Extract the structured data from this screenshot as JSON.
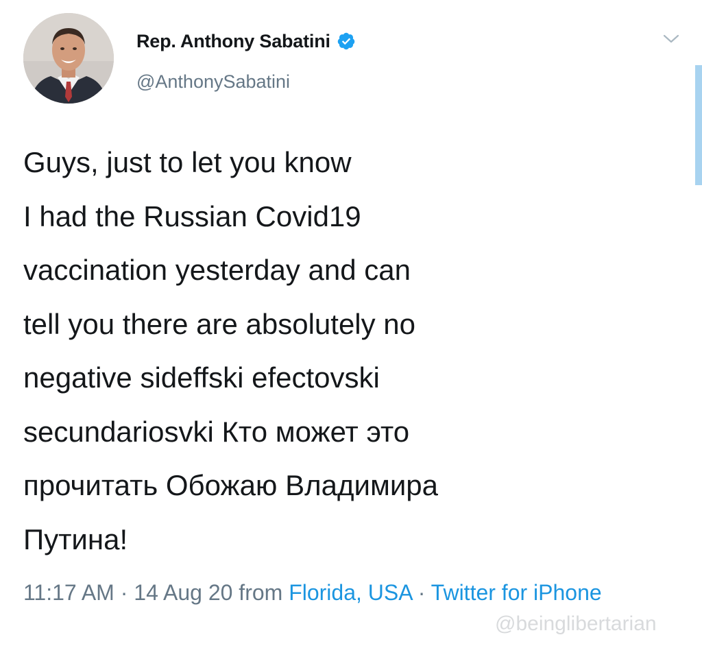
{
  "user": {
    "display_name": "Rep. Anthony Sabatini",
    "handle": "@AnthonySabatini",
    "verified": true
  },
  "icons": {
    "verified": "verified-badge-icon",
    "menu": "chevron-down-icon",
    "avatar": "profile-photo"
  },
  "colors": {
    "verified_badge": "#1da1f2",
    "link": "#1b95e0",
    "secondary_text": "#657786"
  },
  "tweet": {
    "lines": [
      "Guys, just to let you know",
      "I had the Russian Covid19",
      "vaccination yesterday and can",
      "tell you there are absolutely no",
      "negative sideffski efectovski",
      "secundariosvki Кто может это",
      "прочитать Обожаю Владимира",
      "Путина!"
    ]
  },
  "meta": {
    "time": "11:17 AM",
    "separator": " · ",
    "date": "14 Aug 20",
    "from_label": " from ",
    "location": "Florida, USA",
    "client": "Twitter for iPhone"
  },
  "watermark": "@beinglibertarian"
}
